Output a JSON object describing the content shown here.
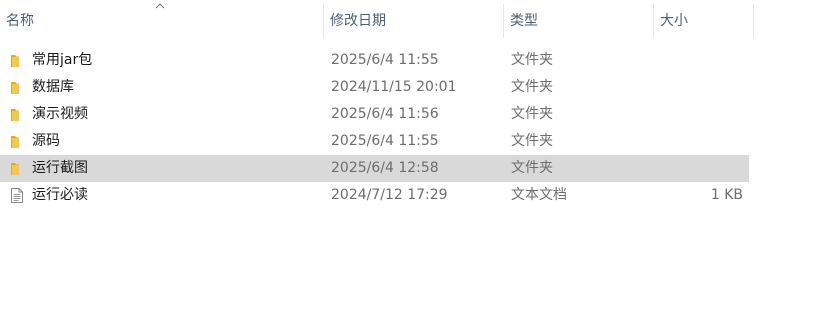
{
  "columns": {
    "name": "名称",
    "date": "修改日期",
    "type": "类型",
    "size": "大小"
  },
  "colors": {
    "folder": "#f5c84c",
    "selected_row": "#d9d9d9",
    "header_text": "#4c607a"
  },
  "rows": [
    {
      "name": "常用jar包",
      "date": "2025/6/4 11:55",
      "type": "文件夹",
      "size": "",
      "icon": "folder-icon"
    },
    {
      "name": "数据库",
      "date": "2024/11/15 20:01",
      "type": "文件夹",
      "size": "",
      "icon": "folder-icon"
    },
    {
      "name": "演示视频",
      "date": "2025/6/4 11:56",
      "type": "文件夹",
      "size": "",
      "icon": "folder-icon"
    },
    {
      "name": "源码",
      "date": "2025/6/4 11:55",
      "type": "文件夹",
      "size": "",
      "icon": "folder-icon"
    },
    {
      "name": "运行截图",
      "date": "2025/6/4 12:58",
      "type": "文件夹",
      "size": "",
      "icon": "folder-icon",
      "selected": true
    },
    {
      "name": "运行必读",
      "date": "2024/7/12 17:29",
      "type": "文本文档",
      "size": "1 KB",
      "icon": "text-file-icon"
    }
  ]
}
